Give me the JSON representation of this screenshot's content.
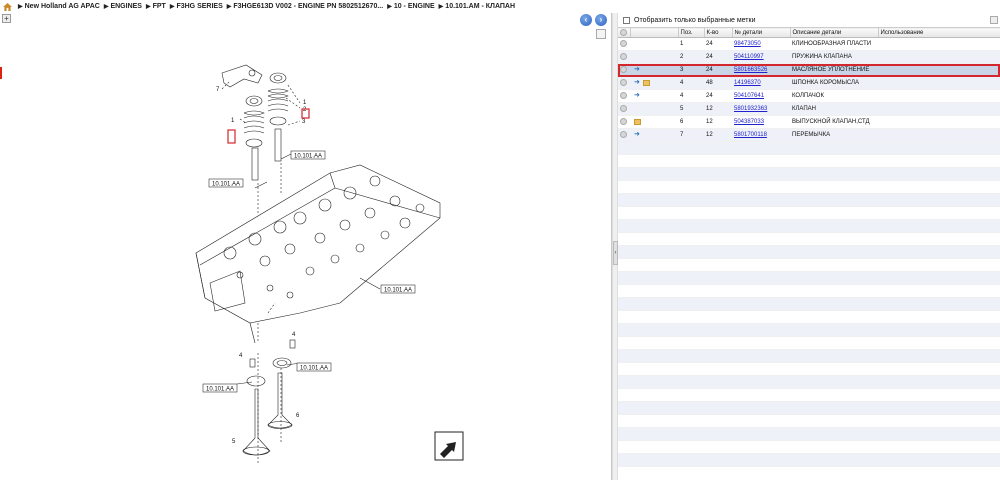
{
  "breadcrumb": {
    "items": [
      "New Holland AG APAC",
      "ENGINES",
      "FPT",
      "F3HG SERIES",
      "F3HGE613D V002 - ENGINE PN 5802512670...",
      "10 - ENGINE",
      "10.101.AM - КЛАПАН"
    ]
  },
  "diagram": {
    "callouts": [
      "10.101.AA",
      "10.101.AA",
      "10.101.AA",
      "10.101.AA",
      "10.101.AA"
    ],
    "numbers": [
      "7",
      "1",
      "2",
      "1",
      "3",
      "4",
      "4",
      "5",
      "6"
    ]
  },
  "filter": {
    "label": "Отобразить только выбранные метки"
  },
  "table": {
    "headers": [
      "",
      "",
      "Поз.",
      "К-во",
      "№ детали",
      "Описание детали",
      "Использование"
    ],
    "rows": [
      {
        "pos": "1",
        "qty": "24",
        "part": "98473050",
        "desc": "КЛИНООБРАЗНАЯ ПЛАСТИ",
        "icons": []
      },
      {
        "pos": "2",
        "qty": "24",
        "part": "504110997",
        "desc": "ПРУЖИНА КЛАПАНА",
        "icons": []
      },
      {
        "pos": "3",
        "qty": "24",
        "part": "5801663526",
        "desc": "МАСЛЯНОЕ УПЛОТНЕНИЕ",
        "icons": [
          "wrench"
        ]
      },
      {
        "pos": "4",
        "qty": "48",
        "part": "14196370",
        "desc": "ШПОНКА КОРОМЫСЛА",
        "icons": [
          "wrench",
          "folder"
        ]
      },
      {
        "pos": "4",
        "qty": "24",
        "part": "504107641",
        "desc": "КОЛПАЧОК",
        "icons": [
          "wrench"
        ]
      },
      {
        "pos": "5",
        "qty": "12",
        "part": "5801932363",
        "desc": "КЛАПАН",
        "icons": []
      },
      {
        "pos": "6",
        "qty": "12",
        "part": "504387033",
        "desc": "ВЫПУСКНОЙ КЛАПАН,СТД",
        "icons": [
          "folder"
        ]
      },
      {
        "pos": "7",
        "qty": "12",
        "part": "5801700118",
        "desc": "ПЕРЕМЫЧКА",
        "icons": [
          "wrench"
        ]
      }
    ]
  },
  "colors": {
    "selection_outline": "#d3262e",
    "link": "#2222cc",
    "nav_button": "#2c63c2"
  }
}
